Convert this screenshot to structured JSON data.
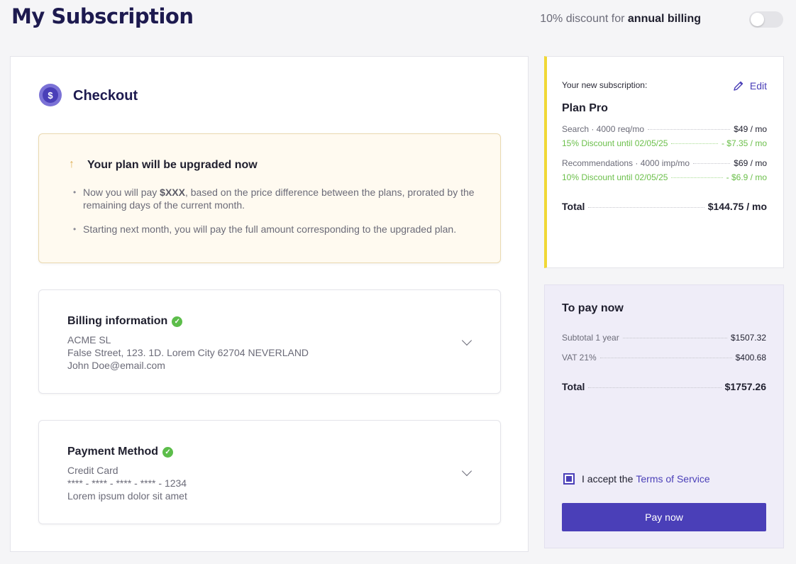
{
  "header": {
    "title": "My Subscription",
    "discount_prefix": "10% discount for",
    "discount_bold": "annual billing"
  },
  "checkout": {
    "title": "Checkout",
    "icon_symbol": "$",
    "upgrade": {
      "title": "Your plan will be upgraded now",
      "bullet1_prefix": "Now you will pay",
      "bullet1_amount": "$XXX",
      "bullet1_suffix": ", based on the price difference between the plans, prorated by the remaining days of the current month.",
      "bullet2": "Starting next month, you will pay the full amount corresponding to the upgraded plan."
    },
    "billing": {
      "title": "Billing information",
      "company": "ACME SL",
      "address": "False Street, 123. 1D. Lorem City 62704 NEVERLAND",
      "email": "John Doe@email.com"
    },
    "payment": {
      "title": "Payment Method",
      "type": "Credit Card",
      "card_number": "**** - **** - **** - **** - 1234",
      "note": "Lorem ipsum dolor sit amet"
    }
  },
  "subscription": {
    "label": "Your new subscription:",
    "edit_label": "Edit",
    "plan_name": "Plan Pro",
    "items": [
      {
        "name": "Search · 4000 req/mo",
        "price": "$49 / mo",
        "discount_name": "15% Discount until 02/05/25",
        "discount_value": "- $7.35 / mo"
      },
      {
        "name": "Recommendations · 4000 imp/mo",
        "price": "$69 / mo",
        "discount_name": "10% Discount until 02/05/25",
        "discount_value": "- $6.9 / mo"
      }
    ],
    "total_label": "Total",
    "total_value": "$144.75 / mo"
  },
  "pay_now": {
    "title": "To pay now",
    "subtotal_label": "Subtotal 1 year",
    "subtotal_value": "$1507.32",
    "vat_label": "VAT 21%",
    "vat_value": "$400.68",
    "total_label": "Total",
    "total_value": "$1757.26",
    "terms_prefix": "I accept the",
    "terms_link": "Terms of Service",
    "button_label": "Pay now"
  },
  "colors": {
    "accent": "#4a3fb8",
    "success": "#5cbd4a",
    "highlight": "#f0d836"
  }
}
